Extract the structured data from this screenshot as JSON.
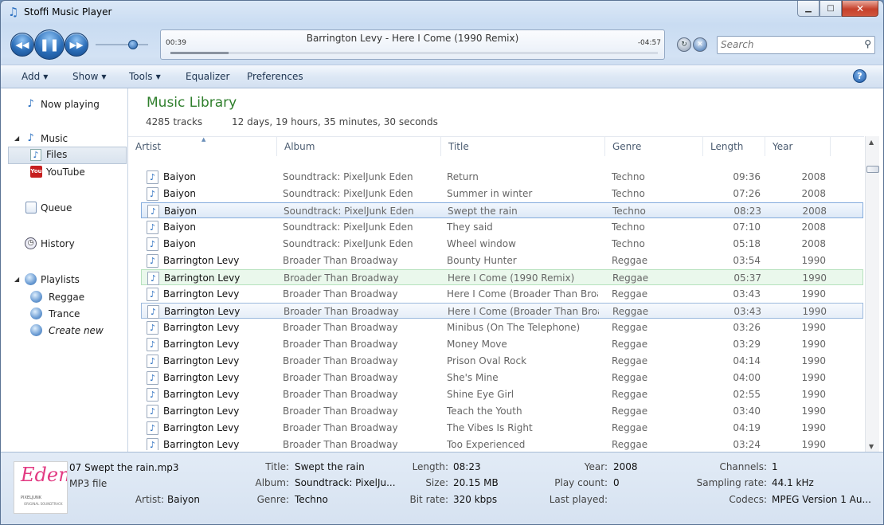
{
  "window": {
    "title": "Stoffi Music Player"
  },
  "player": {
    "elapsed": "00:39",
    "remaining": "-04:57",
    "now_playing": "Barrington Levy - Here I Come (1990 Remix)",
    "progress": 0.12,
    "volume": 0.7
  },
  "search": {
    "placeholder": "Search"
  },
  "menu": {
    "add": "Add",
    "show": "Show",
    "tools": "Tools",
    "equalizer": "Equalizer",
    "preferences": "Preferences"
  },
  "nav": {
    "now_playing": "Now playing",
    "music": "Music",
    "files": "Files",
    "youtube": "YouTube",
    "queue": "Queue",
    "history": "History",
    "playlists": "Playlists",
    "reggae": "Reggae",
    "trance": "Trance",
    "create_new": "Create new"
  },
  "library": {
    "title": "Music Library",
    "track_count": "4285 tracks",
    "duration": "12 days, 19 hours, 35 minutes, 30 seconds",
    "columns": {
      "artist": "Artist",
      "album": "Album",
      "title": "Title",
      "genre": "Genre",
      "length": "Length",
      "year": "Year"
    },
    "rows": [
      {
        "artist": "Baiyon",
        "album": "Soundtrack: PixelJunk Eden",
        "title": "Return",
        "genre": "Techno",
        "length": "09:36",
        "year": "2008"
      },
      {
        "artist": "Baiyon",
        "album": "Soundtrack: PixelJunk Eden",
        "title": "Summer in winter",
        "genre": "Techno",
        "length": "07:26",
        "year": "2008"
      },
      {
        "artist": "Baiyon",
        "album": "Soundtrack: PixelJunk Eden",
        "title": "Swept the rain",
        "genre": "Techno",
        "length": "08:23",
        "year": "2008"
      },
      {
        "artist": "Baiyon",
        "album": "Soundtrack: PixelJunk Eden",
        "title": "They said",
        "genre": "Techno",
        "length": "07:10",
        "year": "2008"
      },
      {
        "artist": "Baiyon",
        "album": "Soundtrack: PixelJunk Eden",
        "title": "Wheel window",
        "genre": "Techno",
        "length": "05:18",
        "year": "2008"
      },
      {
        "artist": "Barrington Levy",
        "album": "Broader Than Broadway",
        "title": "Bounty Hunter",
        "genre": "Reggae",
        "length": "03:54",
        "year": "1990"
      },
      {
        "artist": "Barrington Levy",
        "album": "Broader Than Broadway",
        "title": "Here I Come (1990 Remix)",
        "genre": "Reggae",
        "length": "05:37",
        "year": "1990"
      },
      {
        "artist": "Barrington Levy",
        "album": "Broader Than Broadway",
        "title": "Here I Come (Broader Than Broa",
        "genre": "Reggae",
        "length": "03:43",
        "year": "1990"
      },
      {
        "artist": "Barrington Levy",
        "album": "Broader Than Broadway",
        "title": "Here I Come (Broader Than Broa",
        "genre": "Reggae",
        "length": "03:43",
        "year": "1990"
      },
      {
        "artist": "Barrington Levy",
        "album": "Broader Than Broadway",
        "title": "Minibus (On The Telephone)",
        "genre": "Reggae",
        "length": "03:26",
        "year": "1990"
      },
      {
        "artist": "Barrington Levy",
        "album": "Broader Than Broadway",
        "title": "Money Move",
        "genre": "Reggae",
        "length": "03:29",
        "year": "1990"
      },
      {
        "artist": "Barrington Levy",
        "album": "Broader Than Broadway",
        "title": "Prison Oval Rock",
        "genre": "Reggae",
        "length": "04:14",
        "year": "1990"
      },
      {
        "artist": "Barrington Levy",
        "album": "Broader Than Broadway",
        "title": "She's Mine",
        "genre": "Reggae",
        "length": "04:00",
        "year": "1990"
      },
      {
        "artist": "Barrington Levy",
        "album": "Broader Than Broadway",
        "title": "Shine Eye Girl",
        "genre": "Reggae",
        "length": "02:55",
        "year": "1990"
      },
      {
        "artist": "Barrington Levy",
        "album": "Broader Than Broadway",
        "title": "Teach the Youth",
        "genre": "Reggae",
        "length": "03:40",
        "year": "1990"
      },
      {
        "artist": "Barrington Levy",
        "album": "Broader Than Broadway",
        "title": "The Vibes Is Right",
        "genre": "Reggae",
        "length": "04:19",
        "year": "1990"
      },
      {
        "artist": "Barrington Levy",
        "album": "Broader Than Broadway",
        "title": "Too Experienced",
        "genre": "Reggae",
        "length": "03:24",
        "year": "1990"
      }
    ]
  },
  "details": {
    "cover_text": "Eden",
    "cover_sub": "PIXELJUNK",
    "cover_sub2": "ORIGINAL SOUNDTRACK",
    "filename": "07 Swept the rain.mp3",
    "filetype": "MP3 file",
    "labels": {
      "artist": "Artist:",
      "title": "Title:",
      "album": "Album:",
      "genre": "Genre:",
      "length": "Length:",
      "size": "Size:",
      "bitrate": "Bit rate:",
      "year": "Year:",
      "playcount": "Play count:",
      "lastplayed": "Last played:",
      "channels": "Channels:",
      "sampling": "Sampling rate:",
      "codecs": "Codecs:"
    },
    "values": {
      "artist": "Baiyon",
      "title": "Swept the rain",
      "album": "Soundtrack: PixelJu...",
      "genre": "Techno",
      "length": "08:23",
      "size": "20.15 MB",
      "bitrate": "320 kbps",
      "year": "2008",
      "playcount": "0",
      "lastplayed": "",
      "channels": "1",
      "sampling": "44.1 kHz",
      "codecs": "MPEG Version 1 Au..."
    }
  }
}
